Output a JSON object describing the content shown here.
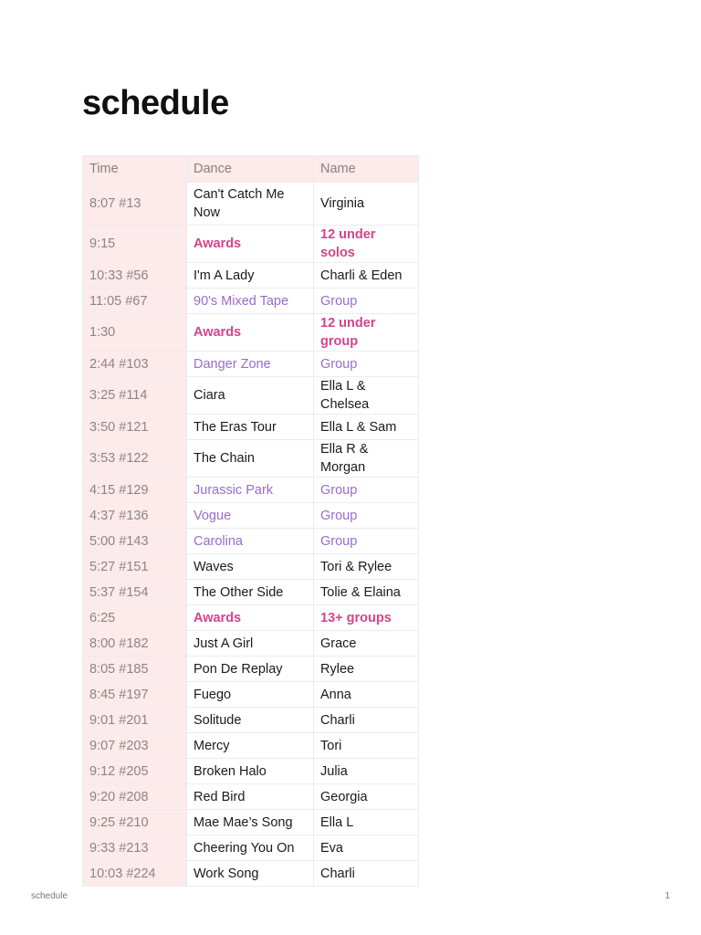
{
  "title": "schedule",
  "table": {
    "headers": [
      "Time",
      "Dance",
      "Name"
    ],
    "rows": [
      {
        "time": "8:07 #13",
        "dance": "Can't Catch Me Now",
        "name": "Virginia",
        "kind": "normal"
      },
      {
        "time": "9:15",
        "dance": "Awards",
        "name": "12 under solos",
        "kind": "awards"
      },
      {
        "time": "10:33 #56",
        "dance": "I'm A Lady",
        "name": "Charli & Eden",
        "kind": "normal"
      },
      {
        "time": "11:05 #67",
        "dance": "90's Mixed Tape",
        "name": "Group",
        "kind": "group"
      },
      {
        "time": "1:30",
        "dance": "Awards",
        "name": "12 under group",
        "kind": "awards"
      },
      {
        "time": "2:44 #103",
        "dance": "Danger Zone",
        "name": "Group",
        "kind": "group"
      },
      {
        "time": "3:25 #114",
        "dance": "Ciara",
        "name": "Ella L & Chelsea",
        "kind": "normal"
      },
      {
        "time": "3:50 #121",
        "dance": "The Eras Tour",
        "name": "Ella L & Sam",
        "kind": "normal"
      },
      {
        "time": "3:53 #122",
        "dance": "The Chain",
        "name": "Ella R & Morgan",
        "kind": "normal"
      },
      {
        "time": "4:15 #129",
        "dance": "Jurassic Park",
        "name": "Group",
        "kind": "group"
      },
      {
        "time": "4:37 #136",
        "dance": "Vogue",
        "name": "Group",
        "kind": "group"
      },
      {
        "time": "5:00 #143",
        "dance": "Carolina",
        "name": "Group",
        "kind": "group"
      },
      {
        "time": "5:27 #151",
        "dance": "Waves",
        "name": "Tori & Rylee",
        "kind": "normal"
      },
      {
        "time": "5:37 #154",
        "dance": "The Other Side",
        "name": "Tolie & Elaina",
        "kind": "normal"
      },
      {
        "time": "6:25",
        "dance": "Awards",
        "name": "13+ groups",
        "kind": "awards"
      },
      {
        "time": "8:00 #182",
        "dance": "Just A Girl",
        "name": "Grace",
        "kind": "normal"
      },
      {
        "time": "8:05 #185",
        "dance": "Pon De Replay",
        "name": "Rylee",
        "kind": "normal"
      },
      {
        "time": "8:45 #197",
        "dance": "Fuego",
        "name": "Anna",
        "kind": "normal"
      },
      {
        "time": "9:01 #201",
        "dance": "Solitude",
        "name": "Charli",
        "kind": "normal"
      },
      {
        "time": "9:07 #203",
        "dance": "Mercy",
        "name": "Tori",
        "kind": "normal"
      },
      {
        "time": "9:12 #205",
        "dance": "Broken Halo",
        "name": "Julia",
        "kind": "normal"
      },
      {
        "time": "9:20 #208",
        "dance": "Red Bird",
        "name": "Georgia",
        "kind": "normal"
      },
      {
        "time": "9:25 #210",
        "dance": "Mae Mae’s Song",
        "name": "Ella L",
        "kind": "normal"
      },
      {
        "time": "9:33 #213",
        "dance": "Cheering You On",
        "name": "Eva",
        "kind": "normal"
      },
      {
        "time": "10:03 #224",
        "dance": "Work Song",
        "name": "Charli",
        "kind": "normal"
      }
    ]
  },
  "footer": {
    "label": "schedule",
    "page": "1"
  },
  "colors": {
    "header_bg": "#fdeaea",
    "awards": "#d0458d",
    "group": "#9b6bc8"
  }
}
